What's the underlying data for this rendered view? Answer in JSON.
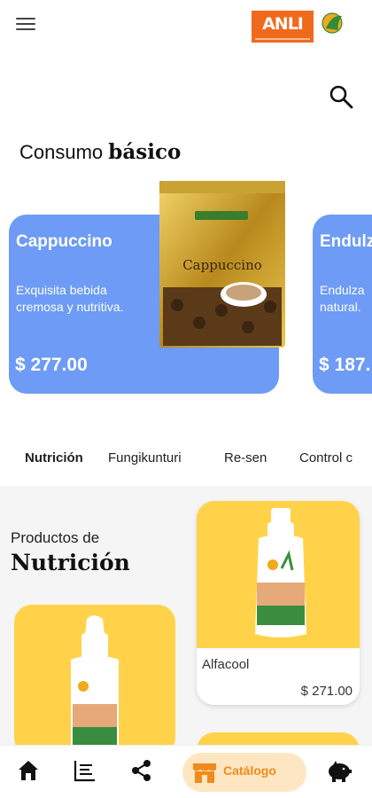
{
  "header": {
    "logo_text": "ANLI",
    "icons": [
      "menu-icon",
      "search-icon"
    ]
  },
  "section": {
    "title_light": "Consumo",
    "title_bold": "básico"
  },
  "featured": [
    {
      "name": "Cappuccino",
      "description": "Exquisita bebida cremosa y nutritiva.",
      "price": "$ 277.00",
      "color": "#6d9bf5"
    },
    {
      "name": "Endulz",
      "description": "Endulza natural.",
      "price": "$ 187."
    }
  ],
  "tabs": [
    "Nutrición",
    "Fungikunturi",
    "Re-sen",
    "Control c"
  ],
  "catalog": {
    "subtitle": "Productos de",
    "title": "Nutrición",
    "products": [
      {
        "name": "Alfacool",
        "price": "$ 271.00"
      }
    ]
  },
  "bottom_nav": {
    "items": [
      "home-icon",
      "list-icon",
      "share-icon",
      "store-icon",
      "piggy-bank-icon"
    ],
    "active_label": "Catálogo",
    "accent": "#f08a1c"
  }
}
